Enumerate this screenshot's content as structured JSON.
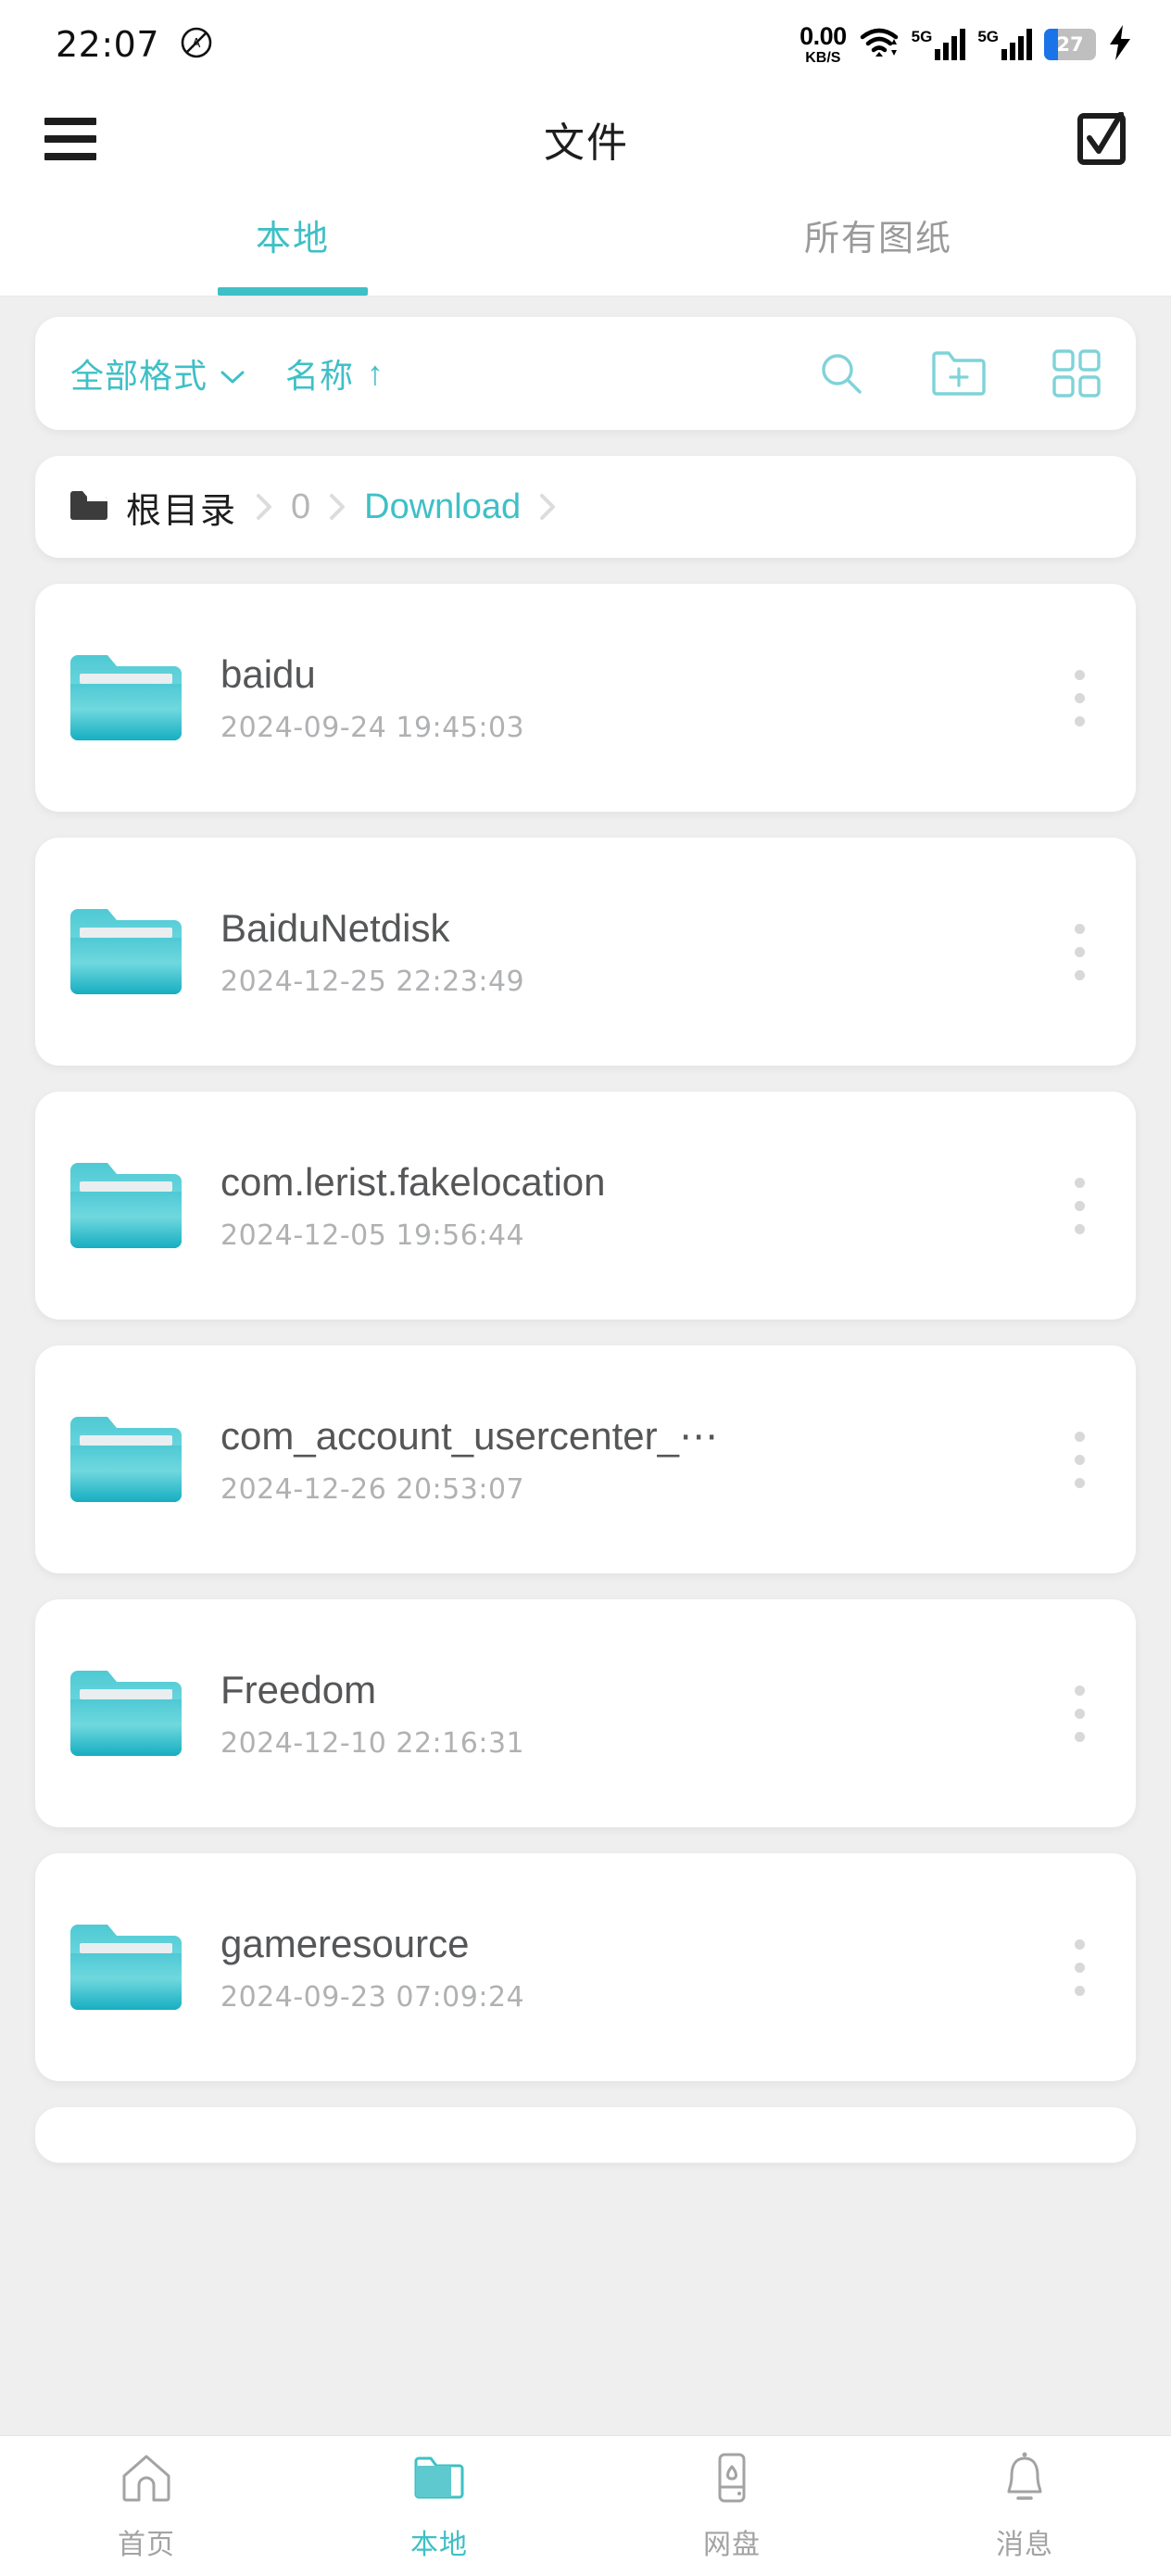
{
  "status_bar": {
    "time": "22:07",
    "dnd_icon": "do-not-disturb-icon",
    "net_speed_value": "0.00",
    "net_speed_unit": "KB/S",
    "wifi_icon": "wifi-icon",
    "sim1_label": "5G",
    "sim2_label": "5G",
    "battery_percent": "27",
    "charging_icon": "lightning-bolt-icon"
  },
  "header": {
    "menu_icon": "hamburger-menu-icon",
    "title": "文件",
    "select_icon": "checkbox-select-icon"
  },
  "tabs": [
    {
      "label": "本地",
      "active": true
    },
    {
      "label": "所有图纸",
      "active": false
    }
  ],
  "toolbar": {
    "format_filter_label": "全部格式",
    "sort_label": "名称",
    "sort_direction": "↑",
    "search_icon": "search-icon",
    "new_folder_icon": "new-folder-icon",
    "grid_view_icon": "grid-view-icon"
  },
  "breadcrumb": {
    "folder_icon": "folder-icon",
    "items": [
      {
        "label": "根目录",
        "style": "root"
      },
      {
        "label": "0",
        "style": "dim"
      },
      {
        "label": "Download",
        "style": "active"
      }
    ]
  },
  "files": [
    {
      "name": "baidu",
      "date": "2024-09-24 19:45:03",
      "icon": "folder-icon",
      "menu_icon": "more-vertical-icon"
    },
    {
      "name": "BaiduNetdisk",
      "date": "2024-12-25 22:23:49",
      "icon": "folder-icon",
      "menu_icon": "more-vertical-icon"
    },
    {
      "name": "com.lerist.fakelocation",
      "date": "2024-12-05 19:56:44",
      "icon": "folder-icon",
      "menu_icon": "more-vertical-icon"
    },
    {
      "name": "com_account_usercenter_⋯",
      "date": "2024-12-26 20:53:07",
      "icon": "folder-icon",
      "menu_icon": "more-vertical-icon"
    },
    {
      "name": "Freedom",
      "date": "2024-12-10 22:16:31",
      "icon": "folder-icon",
      "menu_icon": "more-vertical-icon"
    },
    {
      "name": "gameresource",
      "date": "2024-09-23 07:09:24",
      "icon": "folder-icon",
      "menu_icon": "more-vertical-icon"
    }
  ],
  "bottom_nav": [
    {
      "label": "首页",
      "icon": "home-icon",
      "active": false
    },
    {
      "label": "本地",
      "icon": "folder-icon",
      "active": true
    },
    {
      "label": "网盘",
      "icon": "cloud-drive-icon",
      "active": false
    },
    {
      "label": "消息",
      "icon": "bell-icon",
      "active": false
    }
  ],
  "colors": {
    "accent": "#3ec0c6",
    "page_background": "#efeff0",
    "card": "#ffffff",
    "text_primary": "#555658",
    "text_secondary": "#b0b1b3",
    "battery_fill": "#1a73e8"
  }
}
